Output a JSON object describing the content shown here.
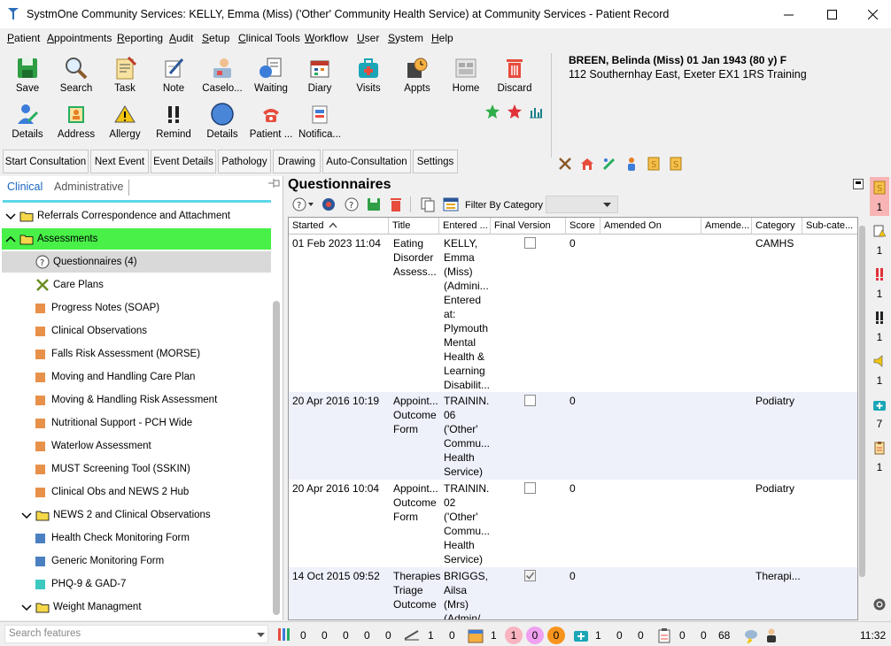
{
  "window": {
    "title": "SystmOne Community Services: KELLY, Emma (Miss) ('Other' Community Health Service) at Community Services - Patient Record"
  },
  "menu": [
    {
      "label": "Patient"
    },
    {
      "label": "Appointments"
    },
    {
      "label": "Reporting"
    },
    {
      "label": "Audit"
    },
    {
      "label": "Setup"
    },
    {
      "label": "Clinical Tools"
    },
    {
      "label": "Workflow"
    },
    {
      "label": "User"
    },
    {
      "label": "System"
    },
    {
      "label": "Help"
    }
  ],
  "toolbar": {
    "row1": [
      {
        "label": "Save",
        "icon": "save-icon"
      },
      {
        "label": "Search",
        "icon": "search-icon"
      },
      {
        "label": "Task",
        "icon": "task-icon"
      },
      {
        "label": "Note",
        "icon": "note-icon"
      },
      {
        "label": "Caselo...",
        "icon": "caseload-icon"
      },
      {
        "label": "Waiting",
        "icon": "waiting-icon"
      },
      {
        "label": "Diary",
        "icon": "diary-icon"
      },
      {
        "label": "Visits",
        "icon": "visits-icon"
      },
      {
        "label": "Appts",
        "icon": "appointments-icon"
      },
      {
        "label": "Home",
        "icon": "home-icon"
      },
      {
        "label": "Discard",
        "icon": "discard-icon"
      }
    ],
    "row2": [
      {
        "label": "Details",
        "icon": "details-icon"
      },
      {
        "label": "Address",
        "icon": "address-icon"
      },
      {
        "label": "Allergy",
        "icon": "allergy-icon"
      },
      {
        "label": "Remind",
        "icon": "remind-icon"
      },
      {
        "label": "Details",
        "icon": "globe-icon"
      },
      {
        "label": "Patient ...",
        "icon": "phone-icon"
      },
      {
        "label": "Notifica...",
        "icon": "notification-icon"
      }
    ]
  },
  "patient": {
    "name": "BREEN, Belinda (Miss) 01 Jan 1943 (80 y) F",
    "address": "112 Southernhay East, Exeter EX1 1RS  Training"
  },
  "tabs": [
    {
      "label": "Start Consultation"
    },
    {
      "label": "Next Event"
    },
    {
      "label": "Event Details"
    },
    {
      "label": "Pathology"
    },
    {
      "label": "Drawing"
    },
    {
      "label": "Auto-Consultation"
    },
    {
      "label": "Settings"
    }
  ],
  "left_panel": {
    "tab_clinical": "Clinical",
    "tab_admin": "Administrative",
    "tree": [
      {
        "label": "Referrals Correspondence and Attachment",
        "kind": "folder",
        "level": 0,
        "expander": "v"
      },
      {
        "label": "Assessments",
        "kind": "folder",
        "level": 0,
        "expander": "^",
        "highlight": "green"
      },
      {
        "label": "Questionnaires (4)",
        "kind": "question",
        "level": 1,
        "highlight": "selected"
      },
      {
        "label": "Care Plans",
        "kind": "careplan",
        "level": 1
      },
      {
        "label": "Progress Notes (SOAP)",
        "kind": "orange",
        "level": 1
      },
      {
        "label": "Clinical Observations",
        "kind": "orange",
        "level": 1
      },
      {
        "label": "Falls Risk Assessment (MORSE)",
        "kind": "orange",
        "level": 1
      },
      {
        "label": "Moving and Handling Care Plan",
        "kind": "orange",
        "level": 1
      },
      {
        "label": "Moving & Handling Risk Assessment",
        "kind": "orange",
        "level": 1
      },
      {
        "label": "Nutritional Support - PCH Wide",
        "kind": "orange",
        "level": 1
      },
      {
        "label": "Waterlow Assessment",
        "kind": "orange",
        "level": 1
      },
      {
        "label": "MUST Screening Tool (SSKIN)",
        "kind": "orange",
        "level": 1
      },
      {
        "label": "Clinical Obs and NEWS 2 Hub",
        "kind": "orange",
        "level": 1
      },
      {
        "label": "NEWS 2 and Clinical Observations",
        "kind": "folder",
        "level": 1,
        "expander": "v"
      },
      {
        "label": "Health Check Monitoring Form",
        "kind": "blue",
        "level": 1
      },
      {
        "label": "Generic Monitoring Form",
        "kind": "blue",
        "level": 1
      },
      {
        "label": "PHQ-9 & GAD-7",
        "kind": "teal",
        "level": 1
      },
      {
        "label": "Weight Managment",
        "kind": "folder",
        "level": 1,
        "expander": "v"
      }
    ]
  },
  "questionnaires": {
    "title": "Questionnaires",
    "filter_label": "Filter By Category",
    "columns": [
      "Started",
      "Title",
      "Entered ...",
      "Final Version",
      "Score",
      "Amended On",
      "Amende...",
      "Category",
      "Sub-cate..."
    ],
    "rows": [
      {
        "started": "01 Feb 2023 11:04",
        "title": [
          "Eating",
          "Disorder",
          "Assess..."
        ],
        "entered": [
          "KELLY,",
          "Emma",
          "(Miss)",
          "(Admini...",
          "Entered",
          "at:",
          "Plymouth",
          "Mental",
          "Health &",
          "Learning",
          "Disabilit..."
        ],
        "final": false,
        "score": "0",
        "category": "CAMHS"
      },
      {
        "started": "20 Apr 2016 10:19",
        "title": [
          "Appoint...",
          "Outcome",
          "Form"
        ],
        "entered": [
          "TRAININ...",
          "06",
          "('Other'",
          "Commu...",
          "Health",
          "Service)"
        ],
        "final": false,
        "score": "0",
        "category": "Podiatry"
      },
      {
        "started": "20 Apr 2016 10:04",
        "title": [
          "Appoint...",
          "Outcome",
          "Form"
        ],
        "entered": [
          "TRAININ...",
          "02",
          "('Other'",
          "Commu...",
          "Health",
          "Service)"
        ],
        "final": false,
        "score": "0",
        "category": "Podiatry"
      },
      {
        "started": "14 Oct 2015 09:52",
        "title": [
          "Therapies",
          "Triage",
          "Outcome"
        ],
        "entered": [
          "BRIGGS,",
          "Ailsa",
          "(Mrs)",
          "(Admin/"
        ],
        "final": true,
        "score": "0",
        "category": "Therapi..."
      }
    ]
  },
  "right_strip": [
    "1",
    "1",
    "1",
    "1",
    "1",
    "7",
    "1"
  ],
  "status": {
    "search_placeholder": "Search features",
    "counts_a": [
      "0",
      "0",
      "0",
      "0",
      "0"
    ],
    "counts_b": [
      "1",
      "0"
    ],
    "counts_c": [
      "1"
    ],
    "circles": [
      {
        "v": "1",
        "color": "#f8b4c0"
      },
      {
        "v": "0",
        "color": "#f0a0f0"
      },
      {
        "v": "0",
        "color": "#f7941d"
      }
    ],
    "counts_d": [
      "1",
      "0",
      "0"
    ],
    "counts_e": [
      "0",
      "0",
      "68"
    ],
    "time": "11:32"
  }
}
